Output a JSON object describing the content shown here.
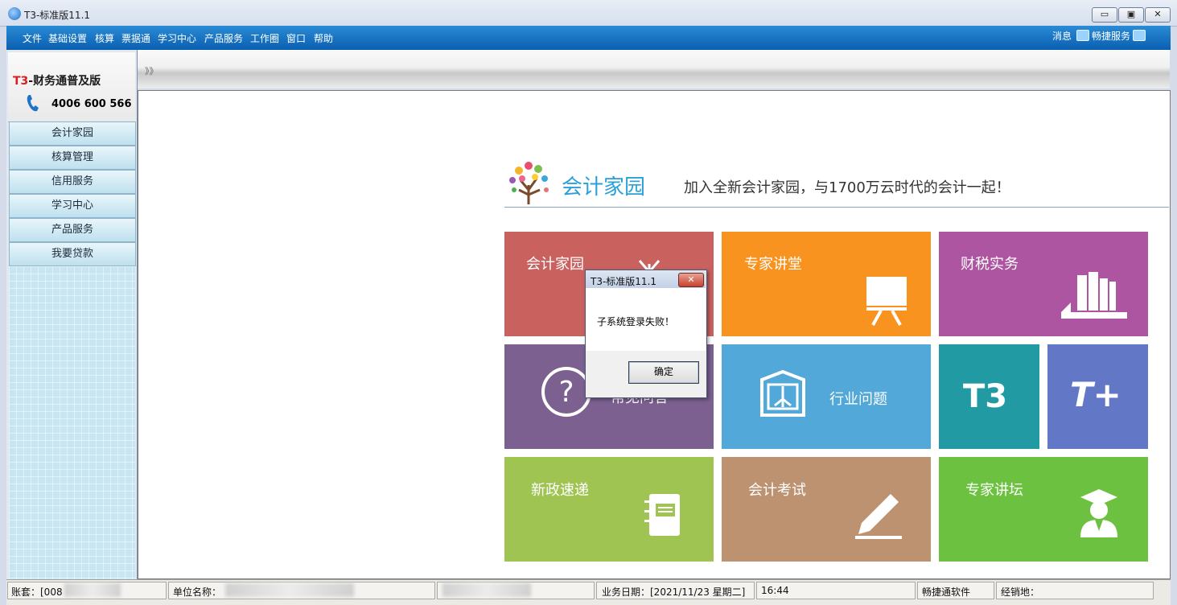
{
  "window": {
    "title": "T3-标准版11.1",
    "controls": {
      "minimize": "▭",
      "restore": "▣",
      "close": "✕"
    }
  },
  "menubar": {
    "items": [
      "文件",
      "基础设置",
      "核算",
      "票据通",
      "学习中心",
      "产品服务",
      "工作圈",
      "窗口",
      "帮助"
    ],
    "messages": "消息",
    "service": "畅捷服务"
  },
  "leftpanel": {
    "logo_prefix": "T3",
    "logo_suffix": "-财务通普及版",
    "phone": "4006 600 566",
    "nav": [
      "会计家园",
      "核算管理",
      "信用服务",
      "学习中心",
      "产品服务",
      "我要贷款"
    ]
  },
  "toolstrip": {
    "arrows": "》》"
  },
  "home": {
    "brand": "会计家园",
    "slogan": "加入全新会计家园，与1700万云时代的会计一起！",
    "tiles": [
      {
        "label": "会计家园",
        "color": "#c9615f"
      },
      {
        "label": "专家讲堂",
        "color": "#f7931e"
      },
      {
        "label": "财税实务",
        "color": "#ad55a0"
      },
      {
        "label": "常见问答",
        "color": "#7b6090"
      },
      {
        "label": "行业问题",
        "color": "#52a8d9"
      },
      {
        "label": "T3",
        "color": "#219aa3"
      },
      {
        "label": "T+",
        "color": "#6277c6"
      },
      {
        "label": "新政速递",
        "color": "#a0c452"
      },
      {
        "label": "会计考试",
        "color": "#bd9271"
      },
      {
        "label": "专家讲坛",
        "color": "#6cc240"
      }
    ]
  },
  "dialog": {
    "title": "T3-标准版11.1",
    "close": "✕",
    "message": "子系统登录失败！",
    "ok": "确定"
  },
  "statusbar": {
    "account_label": "账套：[008",
    "unit_label": "单位名称：",
    "biz_date": "业务日期：[2021/11/23 星期二]",
    "time": "16:44",
    "company": "畅捷通软件",
    "dealer": "经销地："
  }
}
